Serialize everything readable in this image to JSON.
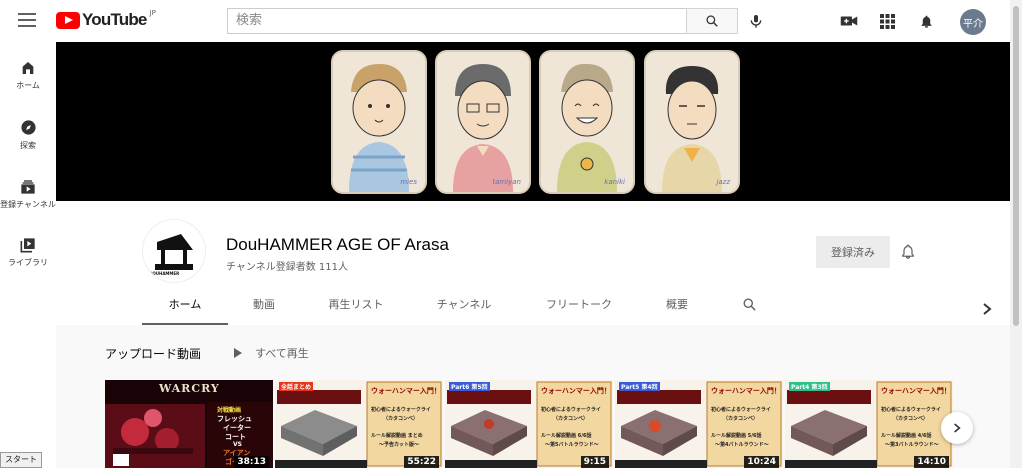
{
  "header": {
    "logo_text": "YouTube",
    "country_code": "JP",
    "search_placeholder": "検索",
    "avatar_text": "平介"
  },
  "sidebar": {
    "items": [
      {
        "label": "ホーム",
        "icon": "home-icon"
      },
      {
        "label": "探索",
        "icon": "compass-icon"
      },
      {
        "label": "登録チャンネル",
        "icon": "subscriptions-icon"
      },
      {
        "label": "ライブラリ",
        "icon": "library-icon"
      }
    ]
  },
  "banner": {
    "signatures": [
      "mies",
      "tamiyan",
      "kaniki",
      "jazz"
    ]
  },
  "channel": {
    "name": "DouHAMMER AGE OF Arasa",
    "subscribers": "チャンネル登録者数 111人",
    "subscribe_label": "登録済み",
    "avatar_text": "DOUHAMMER"
  },
  "tabs": [
    {
      "label": "ホーム",
      "active": true
    },
    {
      "label": "動画",
      "active": false
    },
    {
      "label": "再生リスト",
      "active": false
    },
    {
      "label": "チャンネル",
      "active": false
    },
    {
      "label": "フリートーク",
      "active": false
    },
    {
      "label": "概要",
      "active": false
    }
  ],
  "section": {
    "title": "アップロード動画",
    "play_all": "すべて再生"
  },
  "videos": [
    {
      "duration": "38:13",
      "logo": "WARCRY",
      "caption": [
        "対戦動画",
        "フレッシュ",
        "イーター",
        "コート",
        "VS",
        "アイアン",
        "ゴーレム"
      ]
    },
    {
      "duration": "55:22",
      "tag": "全話まとめ",
      "title": "ウォーハンマー入門！",
      "sub": "初心者によるウォークライ",
      "sub2": "（カタコンベ）",
      "line": "ルール解説動画 まとめ",
      "line2": "～予告カット版～"
    },
    {
      "duration": "9:15",
      "tag": "Part6 第5回",
      "title": "ウォーハンマー入門！",
      "sub": "初心者によるウォークライ",
      "sub2": "（カタコンベ）",
      "line": "ルール解説動画 6/6話",
      "line2": "～第5バトルラウンド～"
    },
    {
      "duration": "10:24",
      "tag": "Part5 第4回",
      "title": "ウォーハンマー入門！",
      "sub": "初心者によるウォークライ",
      "sub2": "（カタコンベ）",
      "line": "ルール解説動画 5/6話",
      "line2": "～第4バトルラウンド～"
    },
    {
      "duration": "14:10",
      "tag": "Part4 第3回",
      "title": "ウォーハンマー入門！",
      "sub": "初心者によるウォークライ",
      "sub2": "（カタコンベ）",
      "line": "ルール解説動画 4/6話",
      "line2": "～第3バトルラウンド～"
    }
  ],
  "status_bar": "スタート",
  "colors": {
    "brand_red": "#ff0000",
    "text_secondary": "#606060"
  }
}
